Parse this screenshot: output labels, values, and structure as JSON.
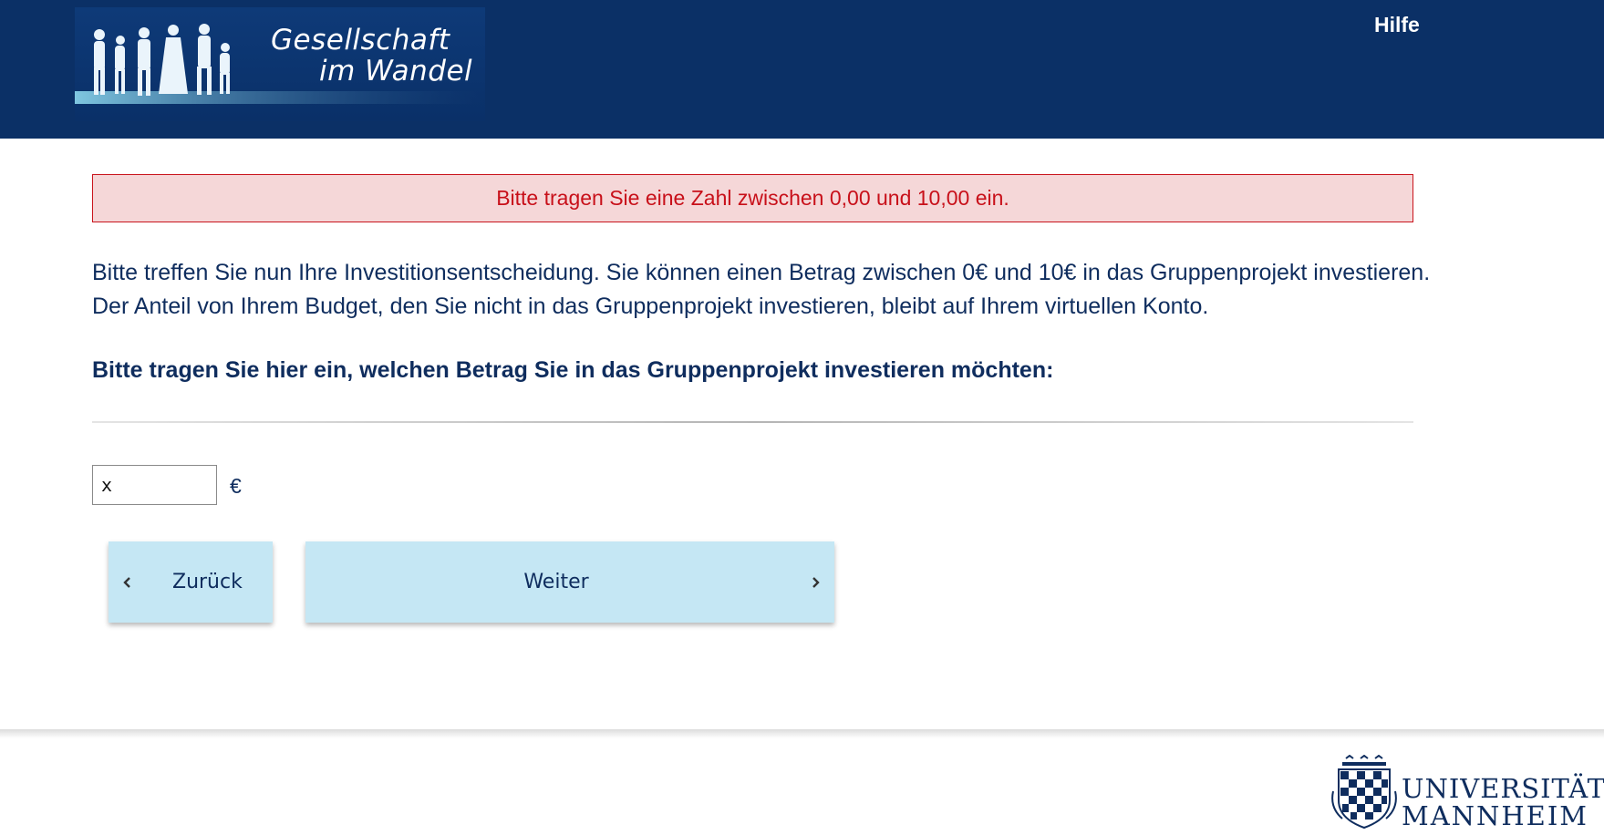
{
  "header": {
    "logo_line1": "Gesellschaft",
    "logo_line2": "im Wandel",
    "help_label": "Hilfe",
    "background_color": "#0b3066"
  },
  "alert": {
    "message": "Bitte tragen Sie eine Zahl zwischen 0,00 und 10,00 ein.",
    "text_color": "#c8101a",
    "background_color": "#f5d7d8"
  },
  "main": {
    "instructions": "Bitte treffen Sie nun Ihre Investitionsentscheidung. Sie können einen Betrag zwischen 0€ und 10€ in das Gruppenprojekt investieren. Der Anteil von Ihrem Budget, den Sie nicht in das Gruppenprojekt investieren, bleibt auf Ihrem virtuellen Konto.",
    "question": "Bitte tragen Sie hier ein, welchen Betrag Sie in das Gruppenprojekt investieren möchten:",
    "amount_value": "x",
    "currency": "€"
  },
  "navigation": {
    "back_label": "Zurück",
    "next_label": "Weiter",
    "button_color": "#c5e7f4"
  },
  "footer": {
    "university_line1": "UNIVERSITÄT",
    "university_line2": "MANNHEIM"
  }
}
